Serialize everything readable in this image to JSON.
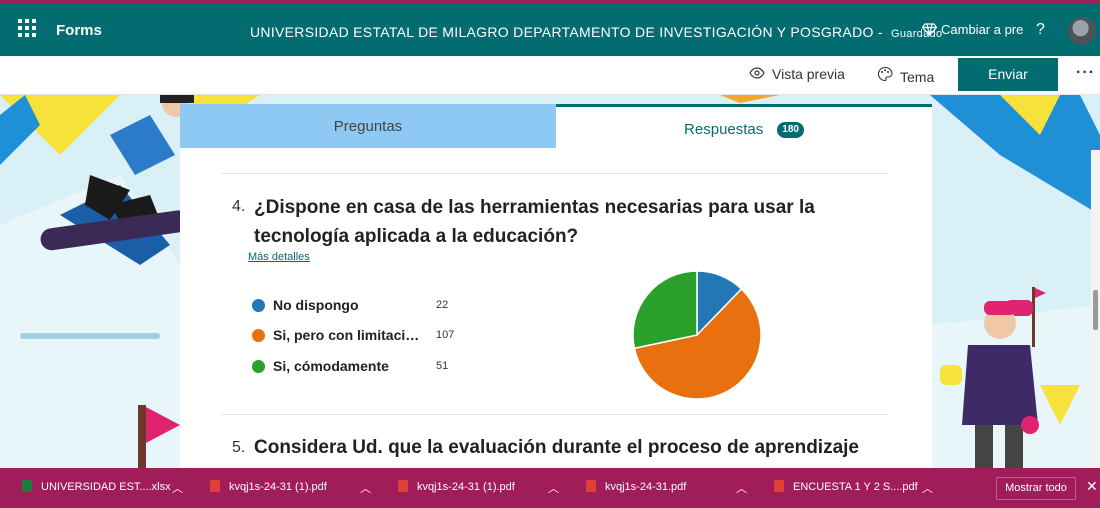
{
  "app": {
    "brand": "Forms",
    "title": "UNIVERSIDAD ESTATAL DE MILAGRO DEPARTAMENTO DE INVESTIGACIÓN Y POSGRADO",
    "saved_sep": " - ",
    "saved": "Guardado",
    "premium": "Cambiar a pren",
    "help": "?"
  },
  "commands": {
    "preview": "Vista previa",
    "theme": "Tema",
    "send": "Enviar",
    "more": "···"
  },
  "tabs": {
    "questions": "Preguntas",
    "responses": "Respuestas",
    "responses_count": "180"
  },
  "question4": {
    "number": "4.",
    "text": "¿Dispone en casa de las herramientas necesarias para usar la tecnología aplicada a la educación?",
    "details_link": "Más detalles",
    "options": [
      {
        "label": "No dispongo",
        "count": "22",
        "color": "#2277b4"
      },
      {
        "label": "Si, pero con limitacio...",
        "count": "107",
        "color": "#e8700e"
      },
      {
        "label": "Si, cómodamente",
        "count": "51",
        "color": "#2ba02b"
      }
    ]
  },
  "question5": {
    "number": "5.",
    "text": "Considera Ud.  que la evaluación durante el proceso de aprendizaje"
  },
  "chart_data": {
    "type": "pie",
    "categories": [
      "No dispongo",
      "Si, pero con limitacio...",
      "Si, cómodamente"
    ],
    "values": [
      22,
      107,
      51
    ],
    "colors": [
      "#2277b4",
      "#e8700e",
      "#2ba02b"
    ]
  },
  "downloads": {
    "items": [
      {
        "name": "UNIVERSIDAD EST....xlsx",
        "type": "xlsx"
      },
      {
        "name": "kvqj1s-24-31 (1).pdf",
        "type": "pdf"
      },
      {
        "name": "kvqj1s-24-31 (1).pdf",
        "type": "pdf"
      },
      {
        "name": "kvqj1s-24-31.pdf",
        "type": "pdf"
      },
      {
        "name": "ENCUESTA 1 Y 2 S....pdf",
        "type": "pdf"
      }
    ],
    "show_all": "Mostrar todo",
    "close": "✕"
  },
  "colors": {
    "teal": "#036c70",
    "download_bar": "#a01d5a",
    "tab_inactive": "#8dc9f2"
  }
}
